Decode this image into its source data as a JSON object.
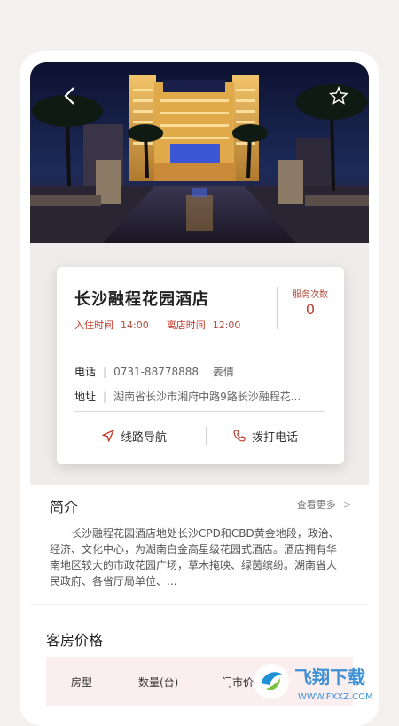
{
  "colors": {
    "accent": "#c0392b",
    "card_bg": "#ffffff",
    "page_bg": "#f3f0ee"
  },
  "header": {
    "back_icon": "chevron-left-icon",
    "favorite_icon": "star-outline-icon"
  },
  "hotel": {
    "name": "长沙融程花园酒店",
    "checkin_label": "入住时间",
    "checkin_time": "14:00",
    "checkout_label": "离店时间",
    "checkout_time": "12:00",
    "service_label": "服务次数",
    "service_count": "0",
    "phone_label": "电话",
    "phone_value": "0731-88778888",
    "contact_name": "姜倩",
    "address_label": "地址",
    "address_value": "湖南省长沙市湘府中路9路长沙融程花...",
    "nav_label": "线路导航",
    "call_label": "拨打电话"
  },
  "intro": {
    "title": "简介",
    "see_more": "查看更多",
    "see_more_arrow": ">",
    "text": "长沙融程花园酒店地处长沙CPD和CBD黄金地段，政治、经济、文化中心，为湖南白金高星级花园式酒店。酒店拥有华南地区较大的市政花园广场，草木掩映、绿茵缤纷。湖南省人民政府、各省厅局单位、..."
  },
  "price": {
    "title": "客房价格",
    "columns": [
      "房型",
      "数量(台)",
      "门市价"
    ]
  },
  "watermark": {
    "brand": "飞翔下载",
    "url": "WWW.FXXZ.COM"
  }
}
